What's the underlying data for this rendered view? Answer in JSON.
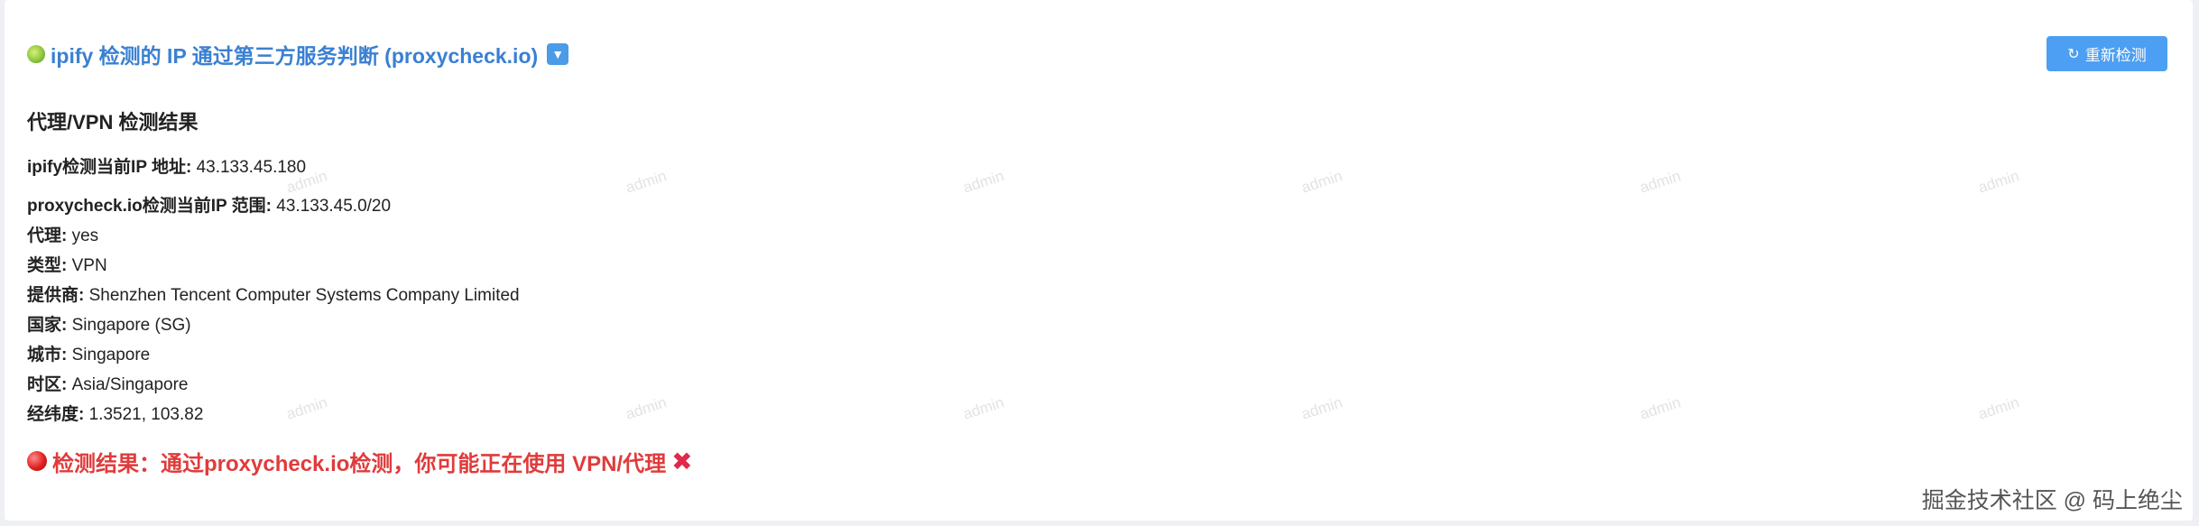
{
  "header": {
    "title": "ipify 检测的 IP 通过第三方服务判断 (proxycheck.io)",
    "expand_icon": "▼"
  },
  "refresh_button": {
    "label": "重新检测",
    "icon": "↻"
  },
  "section_title": "代理/VPN 检测结果",
  "fields": [
    {
      "key": "ipify检测当前IP 地址:",
      "value": "43.133.45.180"
    },
    {
      "key": "proxycheck.io检测当前IP 范围:",
      "value": "43.133.45.0/20"
    },
    {
      "key": "代理:",
      "value": "yes"
    },
    {
      "key": "类型:",
      "value": "VPN"
    },
    {
      "key": "提供商:",
      "value": "Shenzhen Tencent Computer Systems Company Limited"
    },
    {
      "key": "国家:",
      "value": "Singapore (SG)"
    },
    {
      "key": "城市:",
      "value": "Singapore"
    },
    {
      "key": "时区:",
      "value": "Asia/Singapore"
    },
    {
      "key": "经纬度:",
      "value": "1.3521, 103.82"
    }
  ],
  "result": {
    "text": "检测结果：通过proxycheck.io检测，你可能正在使用 VPN/代理",
    "cross": "✖"
  },
  "watermark": "admin",
  "credit": "掘金技术社区 @ 码上绝尘",
  "colors": {
    "accent": "#3a80d2",
    "button": "#4c9ff2",
    "danger": "#e03b3b"
  }
}
